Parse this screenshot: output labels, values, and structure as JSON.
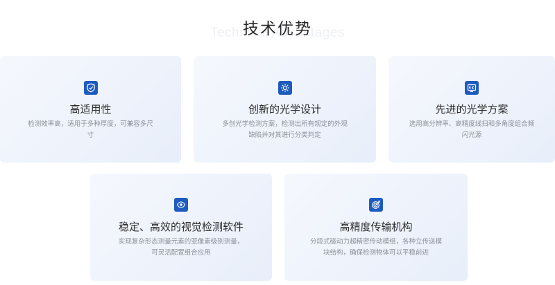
{
  "section": {
    "title": "技术优势",
    "title_en": "Technical Advantages"
  },
  "colors": {
    "accent": "#1e5bbf",
    "card_bg_start": "#f5f8fd",
    "card_bg_end": "#e8eefa",
    "title_text": "#2b2b2b",
    "desc_text": "#8a8f98"
  },
  "cards": [
    {
      "icon": "shield-check-icon",
      "title": "高适用性",
      "desc": "检测效率高，适用于多种厚度，可兼容多尺寸"
    },
    {
      "icon": "light-sun-icon",
      "title": "创新的光学设计",
      "desc": "多创光学检测方案，检测出所有规定的外观缺陷并对其进行分类判定"
    },
    {
      "icon": "4k-display-icon",
      "title": "先进的光学方案",
      "desc": "选用高分辨率、高精度线扫和多角度组合频闪光源"
    },
    {
      "icon": "eye-scan-icon",
      "title": "稳定、高效的视觉检测软件",
      "desc": "实现复杂形态测量元素的亚像素级别测量，可灵活配置组合应用"
    },
    {
      "icon": "target-icon",
      "title": "高精度传输机构",
      "desc": "分段式磁动力超精密传动模组，各种立传送模块结构，确保检测物体可以平稳前进"
    }
  ]
}
